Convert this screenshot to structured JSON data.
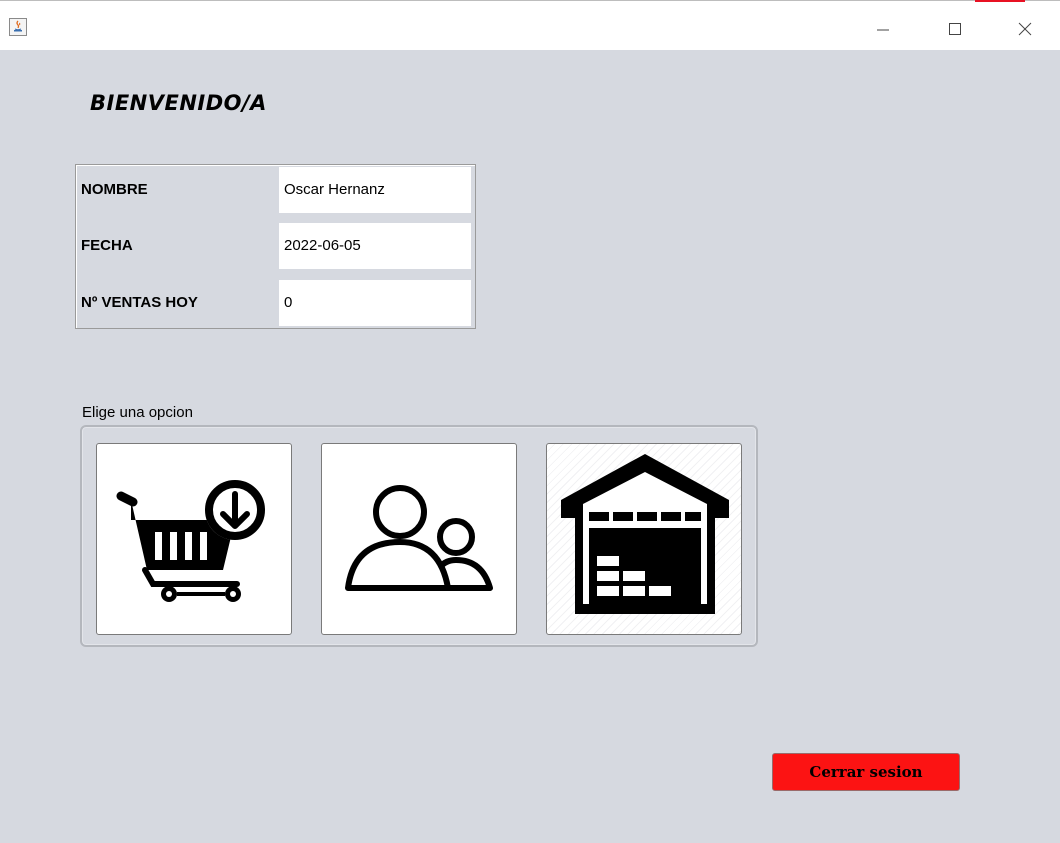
{
  "window": {
    "app_icon": "java-icon",
    "controls": {
      "minimize_icon": "minimize-icon",
      "maximize_icon": "maximize-icon",
      "close_icon": "close-icon"
    },
    "accent_color": "#e81123"
  },
  "header": {
    "welcome": "BIENVENIDO/A"
  },
  "info": {
    "rows": [
      {
        "label": "NOMBRE",
        "value": "Oscar Hernanz"
      },
      {
        "label": "FECHA",
        "value": "2022-06-05"
      },
      {
        "label": "Nº VENTAS HOY",
        "value": "0"
      }
    ]
  },
  "options": {
    "label": "Elige una opcion",
    "buttons": [
      {
        "icon": "cart-download-icon"
      },
      {
        "icon": "users-icon"
      },
      {
        "icon": "warehouse-icon"
      }
    ]
  },
  "logout": {
    "label": "Cerrar sesion",
    "color": "#fc1313"
  },
  "colors": {
    "background": "#d6d9e0"
  }
}
